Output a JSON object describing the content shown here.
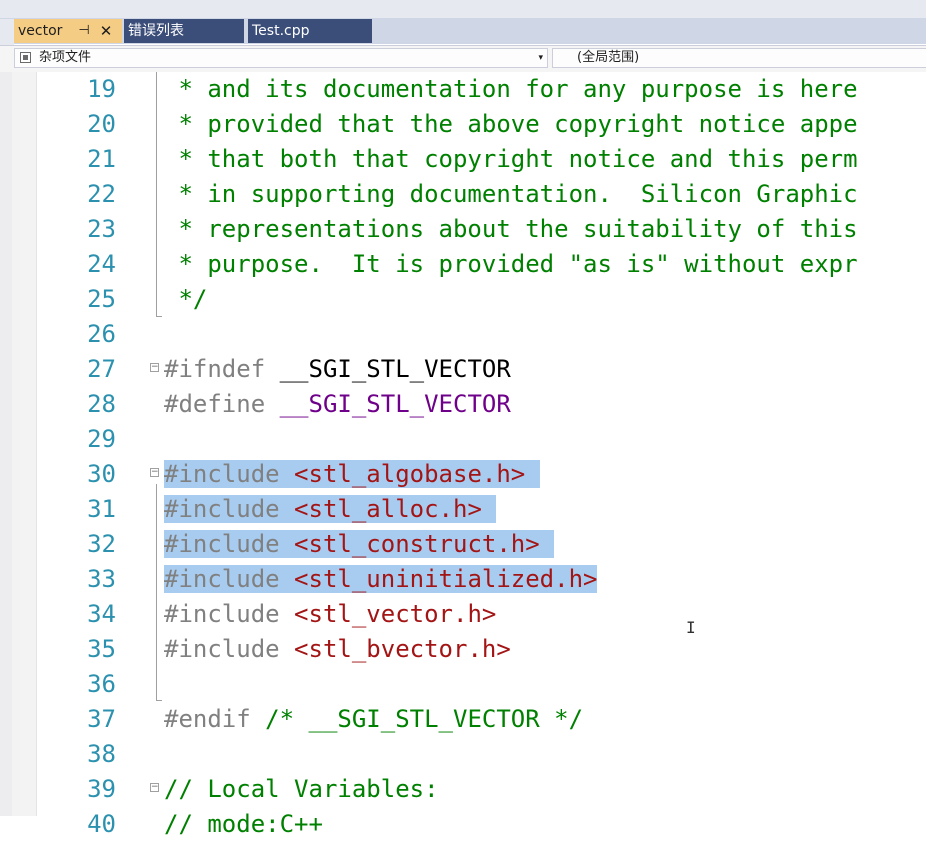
{
  "tabs": {
    "active": {
      "label": "vector",
      "pin": "⊣",
      "close": "✕"
    },
    "others": [
      "错误列表",
      "Test.cpp"
    ]
  },
  "navbar": {
    "project_label": "杂项文件",
    "scope_label": "(全局范围)",
    "dropdown_arrow": "▾"
  },
  "editor": {
    "lines": [
      {
        "n": "19",
        "tokens": [
          {
            "t": " * and its documentation for any purpose is here",
            "c": "comment"
          }
        ]
      },
      {
        "n": "20",
        "tokens": [
          {
            "t": " * provided that the above copyright notice appe",
            "c": "comment"
          }
        ]
      },
      {
        "n": "21",
        "tokens": [
          {
            "t": " * that both that copyright notice and this perm",
            "c": "comment"
          }
        ]
      },
      {
        "n": "22",
        "tokens": [
          {
            "t": " * in supporting documentation.  Silicon Graphic",
            "c": "comment"
          }
        ]
      },
      {
        "n": "23",
        "tokens": [
          {
            "t": " * representations about the suitability of this",
            "c": "comment"
          }
        ]
      },
      {
        "n": "24",
        "tokens": [
          {
            "t": " * purpose.  It is provided \"as is\" without expr",
            "c": "comment"
          }
        ]
      },
      {
        "n": "25",
        "tokens": [
          {
            "t": " */",
            "c": "comment"
          }
        ]
      },
      {
        "n": "26",
        "tokens": []
      },
      {
        "n": "27",
        "tokens": [
          {
            "t": "#ifndef",
            "c": "pre"
          },
          {
            "t": " __SGI_STL_VECTOR",
            "c": ""
          }
        ]
      },
      {
        "n": "28",
        "tokens": [
          {
            "t": "#define",
            "c": "pre"
          },
          {
            "t": " ",
            "c": ""
          },
          {
            "t": "__SGI_STL_VECTOR",
            "c": "macro"
          }
        ]
      },
      {
        "n": "29",
        "tokens": []
      },
      {
        "n": "30",
        "tokens": [
          {
            "t": "#include",
            "c": "pre sel"
          },
          {
            "t": " ",
            "c": "sel"
          },
          {
            "t": "<stl_algobase.h>",
            "c": "str sel"
          },
          {
            "t": " ",
            "c": "sel"
          }
        ]
      },
      {
        "n": "31",
        "tokens": [
          {
            "t": "#include",
            "c": "pre sel"
          },
          {
            "t": " ",
            "c": "sel"
          },
          {
            "t": "<stl_alloc.h>",
            "c": "str sel"
          },
          {
            "t": " ",
            "c": "sel"
          }
        ]
      },
      {
        "n": "32",
        "tokens": [
          {
            "t": "#include",
            "c": "pre sel"
          },
          {
            "t": " ",
            "c": "sel"
          },
          {
            "t": "<stl_construct.h>",
            "c": "str sel"
          },
          {
            "t": " ",
            "c": "sel"
          }
        ]
      },
      {
        "n": "33",
        "tokens": [
          {
            "t": "#include",
            "c": "pre sel"
          },
          {
            "t": " ",
            "c": "sel"
          },
          {
            "t": "<stl_uninitialized.h>",
            "c": "str sel"
          }
        ]
      },
      {
        "n": "34",
        "tokens": [
          {
            "t": "#include",
            "c": "pre"
          },
          {
            "t": " ",
            "c": ""
          },
          {
            "t": "<stl_vector.h>",
            "c": "str"
          }
        ]
      },
      {
        "n": "35",
        "tokens": [
          {
            "t": "#include",
            "c": "pre"
          },
          {
            "t": " ",
            "c": ""
          },
          {
            "t": "<stl_bvector.h>",
            "c": "str"
          }
        ]
      },
      {
        "n": "36",
        "tokens": []
      },
      {
        "n": "37",
        "tokens": [
          {
            "t": "#endif",
            "c": "pre"
          },
          {
            "t": " ",
            "c": ""
          },
          {
            "t": "/* __SGI_STL_VECTOR */",
            "c": "comment"
          }
        ]
      },
      {
        "n": "38",
        "tokens": []
      },
      {
        "n": "39",
        "tokens": [
          {
            "t": "// Local Variables:",
            "c": "comment"
          }
        ]
      },
      {
        "n": "40",
        "tokens": [
          {
            "t": "// mode:C++",
            "c": "comment"
          }
        ]
      }
    ],
    "fold_markers": [
      "27",
      "30",
      "39"
    ],
    "text_cursor": "I"
  },
  "colors": {
    "line_number": "#2b91af",
    "comment": "#008000",
    "preprocessor": "#808080",
    "macro": "#6f008a",
    "string": "#a31515",
    "selection": "#a8ccf0",
    "active_tab": "#f5cc84",
    "inactive_tab": "#3b4e7a"
  }
}
